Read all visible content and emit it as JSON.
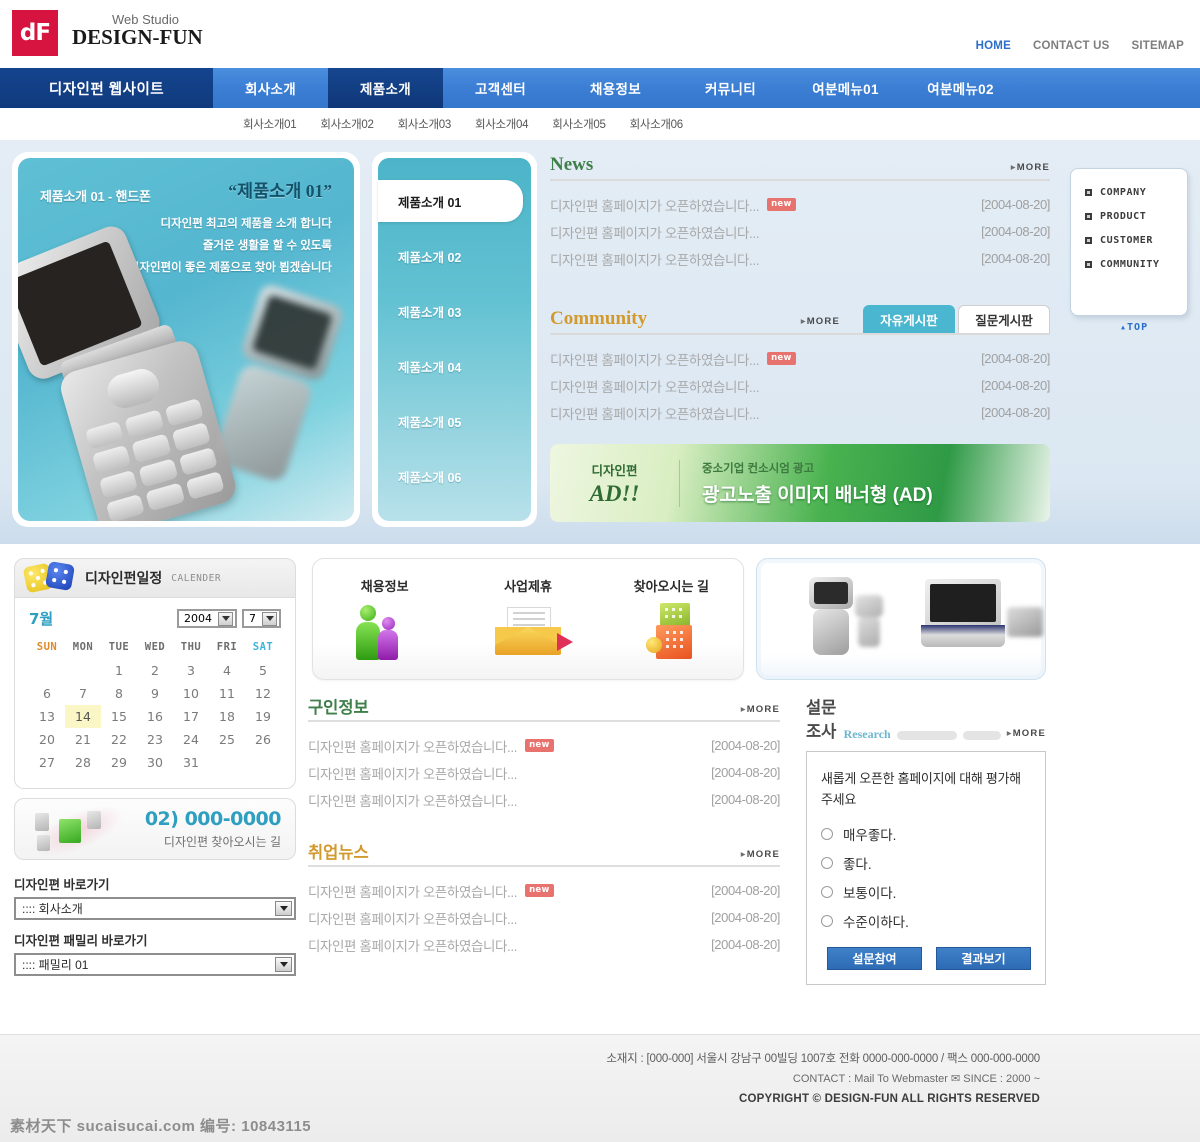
{
  "header": {
    "logo_mark": "dF",
    "logo_sub": "Web Studio",
    "logo_main": "DESIGN-FUN",
    "top_links": [
      {
        "label": "HOME",
        "active": true
      },
      {
        "label": "CONTACT US",
        "active": false
      },
      {
        "label": "SITEMAP",
        "active": false
      }
    ]
  },
  "nav": {
    "brand": "디자인펀 웹사이트",
    "items": [
      {
        "label": "회사소개",
        "active": false
      },
      {
        "label": "제품소개",
        "active": true
      },
      {
        "label": "고객센터",
        "active": false
      },
      {
        "label": "채용정보",
        "active": false
      },
      {
        "label": "커뮤니티",
        "active": false
      },
      {
        "label": "여분메뉴01",
        "active": false
      },
      {
        "label": "여분메뉴02",
        "active": false
      }
    ],
    "sub_items": [
      "회사소개01",
      "회사소개02",
      "회사소개03",
      "회사소개04",
      "회사소개05",
      "회사소개06"
    ]
  },
  "hero": {
    "caption": "제품소개 01 - 핸드폰",
    "quote": "“제품소개 01”",
    "lines": [
      "디자인편 최고의 제품을 소개 합니다",
      "즐거운 생활을 할 수 있도록",
      "디자인편이 좋은 제품으로 찾아 뵙겠습니다"
    ],
    "menu": [
      {
        "label": "제품소개 01",
        "active": true
      },
      {
        "label": "제품소개 02",
        "active": false
      },
      {
        "label": "제품소개 03",
        "active": false
      },
      {
        "label": "제품소개 04",
        "active": false
      },
      {
        "label": "제품소개 05",
        "active": false
      },
      {
        "label": "제품소개 06",
        "active": false
      }
    ]
  },
  "news": {
    "title": "News",
    "more": "MORE",
    "rows": [
      {
        "text": "디자인편 홈페이지가 오픈하였습니다...",
        "new": true,
        "date": "[2004-08-20]"
      },
      {
        "text": "디자인편 홈페이지가 오픈하였습니다...",
        "new": false,
        "date": "[2004-08-20]"
      },
      {
        "text": "디자인편 홈페이지가 오픈하였습니다...",
        "new": false,
        "date": "[2004-08-20]"
      }
    ]
  },
  "community": {
    "title": "Community",
    "more": "MORE",
    "tabs": [
      {
        "label": "자유게시판",
        "active": true
      },
      {
        "label": "질문게시판",
        "active": false
      }
    ],
    "rows": [
      {
        "text": "디자인편 홈페이지가 오픈하였습니다...",
        "new": true,
        "date": "[2004-08-20]"
      },
      {
        "text": "디자인편 홈페이지가 오픈하였습니다...",
        "new": false,
        "date": "[2004-08-20]"
      },
      {
        "text": "디자인편 홈페이지가 오픈하였습니다...",
        "new": false,
        "date": "[2004-08-20]"
      }
    ]
  },
  "ad": {
    "left_top": "디자인편",
    "left_bottom": "AD!!",
    "right_top": "중소기업 컨소시엄 광고",
    "right_bottom": "광고노출 이미지 배너형 (AD)"
  },
  "quick_panel": {
    "items": [
      "COMPANY",
      "PRODUCT",
      "CUSTOMER",
      "COMMUNITY"
    ],
    "top_label": "TOP"
  },
  "calendar": {
    "title": "디자인펀일정",
    "subtitle": "CALENDER",
    "month_label": "7월",
    "year_value": "2004",
    "month_value": "7",
    "weekdays": [
      "SUN",
      "MON",
      "TUE",
      "WED",
      "THU",
      "FRI",
      "SAT"
    ],
    "today": 14,
    "weeks": [
      [
        "",
        "",
        "1",
        "2",
        "3",
        "4",
        "5"
      ],
      [
        "6",
        "7",
        "8",
        "9",
        "10",
        "11",
        "12"
      ],
      [
        "13",
        "14",
        "15",
        "16",
        "17",
        "18",
        "19"
      ],
      [
        "20",
        "21",
        "22",
        "23",
        "24",
        "25",
        "26"
      ],
      [
        "27",
        "28",
        "29",
        "30",
        "31",
        "",
        ""
      ]
    ]
  },
  "contact": {
    "tel": "02) 000-0000",
    "sub": "디자인편 찾아오시는 길"
  },
  "shortcuts": [
    {
      "label": "디자인편 바로가기",
      "value": ":::: 회사소개"
    },
    {
      "label": "디자인편 패밀리 바로가기",
      "value": ":::: 패밀리 01"
    }
  ],
  "icon_links": [
    {
      "label": "채용정보",
      "icon": "people-icon"
    },
    {
      "label": "사업제휴",
      "icon": "envelope-icon"
    },
    {
      "label": "찾아오시는 길",
      "icon": "buildings-icon"
    }
  ],
  "jobs": {
    "title": "구인정보",
    "more": "MORE",
    "rows": [
      {
        "text": "디자인편 홈페이지가 오픈하였습니다...",
        "new": true,
        "date": "[2004-08-20]"
      },
      {
        "text": "디자인편 홈페이지가 오픈하였습니다...",
        "new": false,
        "date": "[2004-08-20]"
      },
      {
        "text": "디자인편 홈페이지가 오픈하였습니다...",
        "new": false,
        "date": "[2004-08-20]"
      }
    ]
  },
  "jobnews": {
    "title": "취업뉴스",
    "more": "MORE",
    "rows": [
      {
        "text": "디자인편 홈페이지가 오픈하였습니다...",
        "new": true,
        "date": "[2004-08-20]"
      },
      {
        "text": "디자인편 홈페이지가 오픈하였습니다...",
        "new": false,
        "date": "[2004-08-20]"
      },
      {
        "text": "디자인편 홈페이지가 오픈하였습니다...",
        "new": false,
        "date": "[2004-08-20]"
      }
    ]
  },
  "survey": {
    "title": "설문조사",
    "subtitle": "Research",
    "more": "MORE",
    "question": "새롭게 오픈한 홈페이지에 대해 평가해주세요",
    "options": [
      "매우좋다.",
      "좋다.",
      "보통이다.",
      "수준이하다."
    ],
    "submit_label": "설문참여",
    "result_label": "결과보기"
  },
  "footer": {
    "line1": "소재지 : [000-000] 서울시 강남구 00빌딩 1007호  전화 0000-000-0000 / 팩스 000-000-0000",
    "line2": "CONTACT : Mail To Webmaster ✉     SINCE : 2000 ~",
    "line3": "COPYRIGHT © DESIGN-FUN ALL RIGHTS RESERVED",
    "watermark": "素材天下 sucaisucai.com  编号: 10843115"
  },
  "colors": {
    "nav_blue": "#3b7ed4",
    "nav_dark": "#14448f",
    "accent_cyan": "#4bb6cf",
    "logo_red": "#d71440",
    "news_green": "#3f7f4a",
    "community_orange": "#d29a2e",
    "new_badge": "#e8736e",
    "button_blue": "#2d6cb5"
  }
}
